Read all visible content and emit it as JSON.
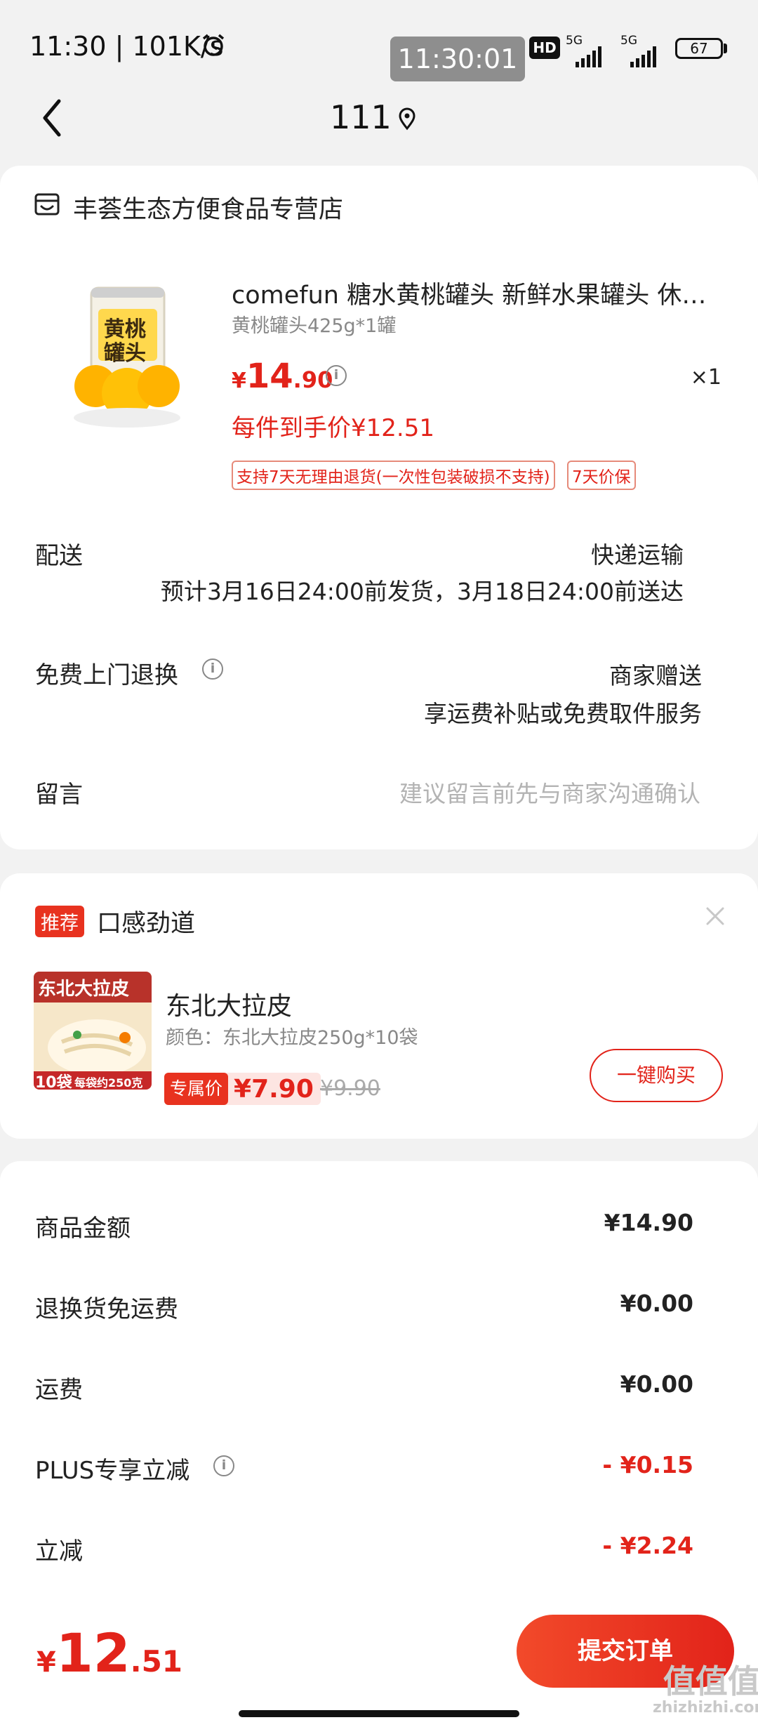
{
  "status_bar": {
    "time": "11:30 | 101K/s",
    "clock_pill": "11:30:01",
    "hd": "HD",
    "net1": "5G",
    "net2": "5G",
    "battery": "67"
  },
  "nav": {
    "title": "111"
  },
  "store": {
    "name": "丰荟生态方便食品专营店"
  },
  "product": {
    "title": "comefun 糖水黄桃罐头 新鲜水果罐头 休…",
    "spec": "黄桃罐头425g*1罐",
    "price_symbol": "¥",
    "price_int": "14",
    "price_dec": ".90",
    "qty": "×1",
    "unit_price": "每件到手价¥12.51",
    "tags": [
      "支持7天无理由退货(一次性包装破损不支持)",
      "7天价保"
    ],
    "image_label_line1": "黄桃",
    "image_label_line2": "罐头"
  },
  "delivery": {
    "label": "配送",
    "method": "快递运输",
    "estimate": "预计3月16日24:00前发货，3月18日24:00前送达"
  },
  "return_service": {
    "label": "免费上门退换",
    "right_line1": "商家赠送",
    "right_line2": "享运费补贴或免费取件服务"
  },
  "message": {
    "label": "留言",
    "placeholder": "建议留言前先与商家沟通确认"
  },
  "recommend": {
    "badge": "推荐",
    "title": "口感劲道",
    "item_name": "东北大拉皮",
    "item_spec": "颜色：东北大拉皮250g*10袋",
    "price_label": "专属价",
    "price": "¥7.90",
    "old_price": "¥9.90",
    "buy_label": "一键购买",
    "image_text_top": "东北大拉皮",
    "image_text_bottom": "10袋",
    "image_text_sub": "每袋约250克"
  },
  "summary": [
    {
      "label": "商品金额",
      "value": "¥14.90",
      "red": false,
      "info": false
    },
    {
      "label": "退换货免运费",
      "value": "¥0.00",
      "red": false,
      "info": false
    },
    {
      "label": "运费",
      "value": "¥0.00",
      "red": false,
      "info": false
    },
    {
      "label": "PLUS专享立减",
      "value": "- ¥0.15",
      "red": true,
      "info": true
    },
    {
      "label": "立减",
      "value": "- ¥2.24",
      "red": true,
      "info": false
    }
  ],
  "footer": {
    "total_symbol": "¥",
    "total_int": "12",
    "total_dec": ".51",
    "submit_label": "提交订单",
    "watermark_line1": "值值值",
    "watermark_line2": "zhizhizhi.com"
  },
  "colors": {
    "accent": "#e2231a",
    "background": "#f2f2f2"
  }
}
